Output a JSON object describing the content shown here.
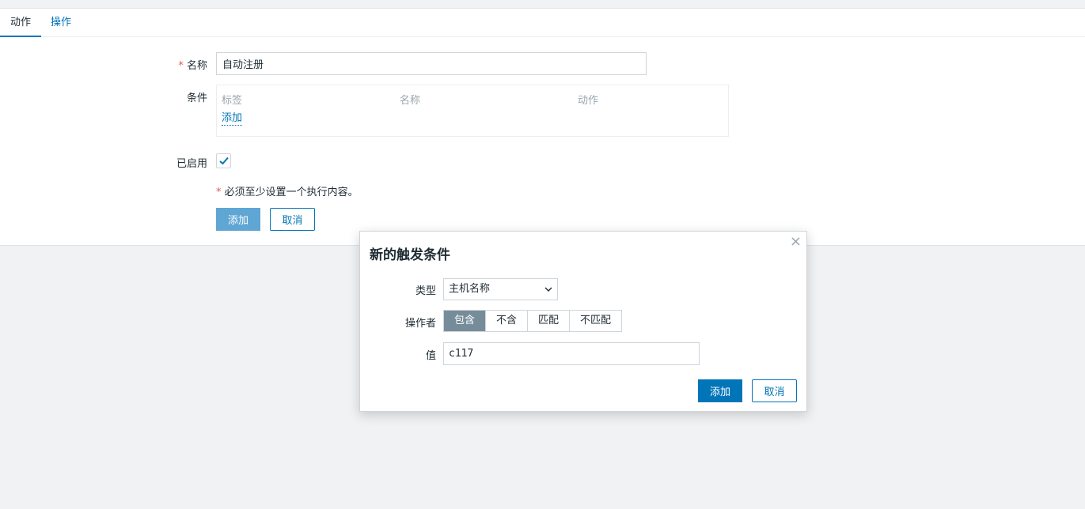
{
  "tabs": [
    "动作",
    "操作"
  ],
  "form": {
    "name_required_mark": "*",
    "name_label": "名称",
    "name_value": "自动注册",
    "conditions_label": "条件",
    "conditions_headers": [
      "标签",
      "名称",
      "动作"
    ],
    "conditions_add": "添加",
    "enabled_label": "已启用",
    "enabled_checked": true,
    "note_mark": "*",
    "note_text": "必须至少设置一个执行内容。",
    "add_button": "添加",
    "cancel_button": "取消"
  },
  "dialog": {
    "title": "新的触发条件",
    "close_symbol": "×",
    "type_label": "类型",
    "type_value": "主机名称",
    "operator_label": "操作者",
    "operators": [
      "包含",
      "不含",
      "匹配",
      "不匹配"
    ],
    "operator_selected": "包含",
    "value_label": "值",
    "value": "c117",
    "add_button": "添加",
    "cancel_button": "取消"
  },
  "colors": {
    "accent": "#0275b8",
    "required": "#e45959",
    "active_segment": "#768d99",
    "background": "#f0f2f4"
  }
}
